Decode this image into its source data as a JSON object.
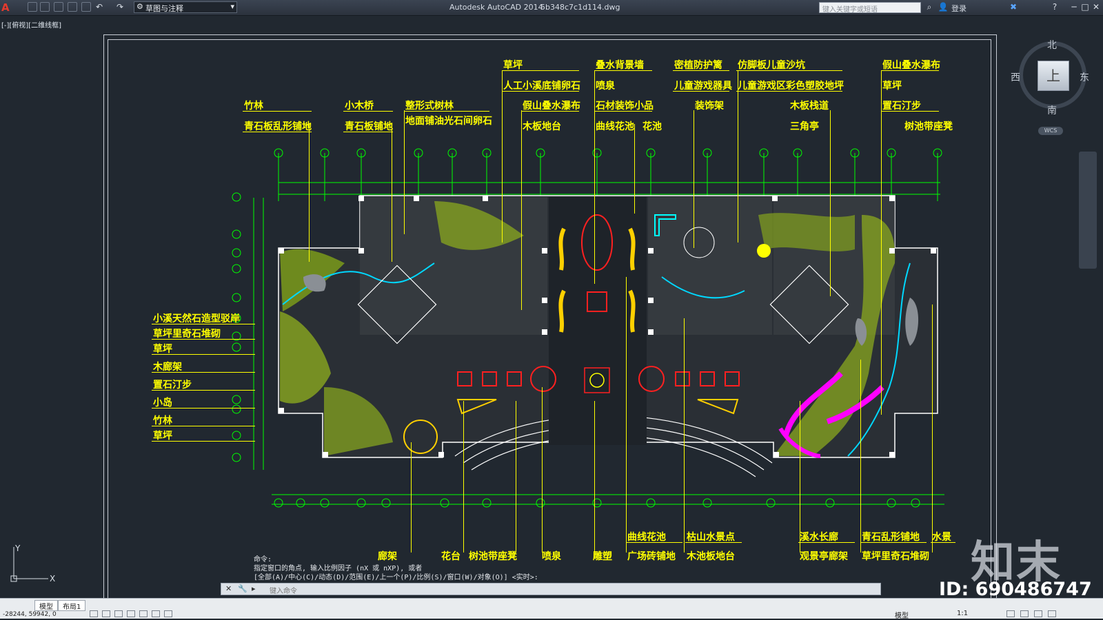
{
  "titlebar": {
    "app": "Autodesk AutoCAD 2014",
    "file": "5b348c7c1d114.dwg",
    "workspace": "草图与注释",
    "search_placeholder": "键入关键字或短语",
    "login": "登录"
  },
  "viewport_label": "[-][俯视][二维线框]",
  "viewcube": {
    "north": "北",
    "south": "南",
    "east": "东",
    "west": "西",
    "face": "上",
    "wcs": "WCS"
  },
  "labels_top": [
    {
      "text": "竹林"
    },
    {
      "text": "青石板乱形铺地"
    },
    {
      "text": "小木桥"
    },
    {
      "text": "青石板铺地"
    },
    {
      "text": "整形式树林"
    },
    {
      "text": "地面铺油光石间卵石"
    },
    {
      "text": "草坪"
    },
    {
      "text": "人工小溪底铺卵石"
    },
    {
      "text": "假山叠水瀑布"
    },
    {
      "text": "木板地台"
    },
    {
      "text": "叠水背景墙"
    },
    {
      "text": "喷泉"
    },
    {
      "text": "石材装饰小品"
    },
    {
      "text": "曲线花池"
    },
    {
      "text": "花池"
    },
    {
      "text": "密植防护篱"
    },
    {
      "text": "儿童游戏器具"
    },
    {
      "text": "装饰架"
    },
    {
      "text": "仿脚板儿童沙坑"
    },
    {
      "text": "儿童游戏区彩色塑胶地坪"
    },
    {
      "text": "木板栈道"
    },
    {
      "text": "三角亭"
    },
    {
      "text": "假山叠水瀑布"
    },
    {
      "text": "草坪"
    },
    {
      "text": "置石汀步"
    },
    {
      "text": "树池带座凳"
    }
  ],
  "labels_left": [
    "小溪天然石造型驳岸",
    "草坪里奇石堆砌",
    "草坪",
    "木廊架",
    "置石汀步",
    "小岛",
    "竹林",
    "草坪"
  ],
  "labels_bottom": [
    {
      "text": "廊架"
    },
    {
      "text": "花台"
    },
    {
      "text": "树池带座凳"
    },
    {
      "text": "喷泉"
    },
    {
      "text": "雕塑"
    },
    {
      "text": "曲线花池"
    },
    {
      "text": "广场砖铺地"
    },
    {
      "text": "枯山水景点"
    },
    {
      "text": "木池板地台"
    },
    {
      "text": "溪水长廊"
    },
    {
      "text": "观景亭廊架"
    },
    {
      "text": "青石乱形铺地"
    },
    {
      "text": "草坪里奇石堆砌"
    },
    {
      "text": "水景"
    }
  ],
  "command": {
    "line1": "命令:",
    "line2": "指定窗口的角点, 输入比例因子 (nX 或 nXP), 或者",
    "line3": "[全部(A)/中心(C)/动态(D)/范围(E)/上一个(P)/比例(S)/窗口(W)/对象(O)] <实时>:",
    "placeholder": "键入命令"
  },
  "status": {
    "tab_model": "模型",
    "tab_layout": "布局1",
    "coords": "-28244, 59942, 0",
    "model_label": "模型",
    "scale": "1:1"
  },
  "watermark": {
    "logo": "知末",
    "id": "ID: 690486747"
  },
  "colors": {
    "label": "#ffff00",
    "background": "#212830",
    "grid": "#00ff00"
  }
}
